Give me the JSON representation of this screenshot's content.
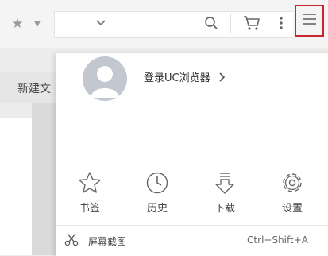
{
  "toolbar": {
    "star_icon": "star-icon",
    "search_icon": "search-icon",
    "cart_icon": "cart-icon",
    "more_icon": "more-vertical-icon",
    "menu_icon": "hamburger-menu-icon",
    "highlight_color": "#c7262f"
  },
  "page": {
    "tab_label": "新建文"
  },
  "menu": {
    "login_label": "登录UC浏览器",
    "quick_actions": [
      {
        "label": "书签",
        "icon": "bookmark-star-icon"
      },
      {
        "label": "历史",
        "icon": "history-clock-icon"
      },
      {
        "label": "下载",
        "icon": "download-icon"
      },
      {
        "label": "设置",
        "icon": "settings-gear-icon"
      }
    ],
    "screenshot": {
      "label": "屏幕截图",
      "shortcut": "Ctrl+Shift+A",
      "icon": "scissors-icon"
    }
  }
}
